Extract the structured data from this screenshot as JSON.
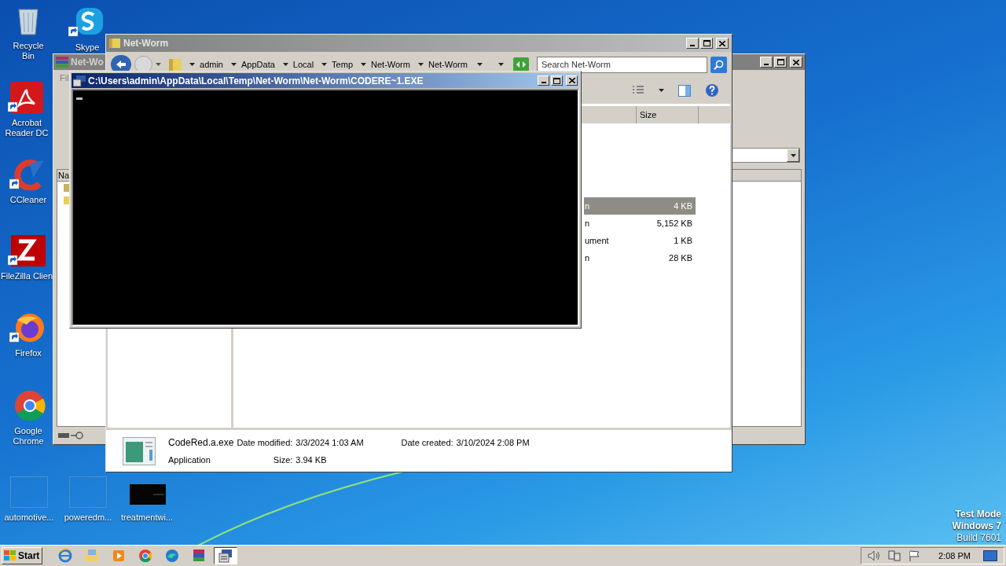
{
  "desktop_icons": [
    {
      "label": "Recycle Bin",
      "kind": "recycle"
    },
    {
      "label": "Skype",
      "kind": "skype"
    },
    {
      "label": "Acrobat Reader DC",
      "kind": "acrobat"
    },
    {
      "label": "CCleaner",
      "kind": "ccleaner"
    },
    {
      "label": "FileZilla Clien",
      "kind": "filezilla"
    },
    {
      "label": "Firefox",
      "kind": "firefox"
    },
    {
      "label": "Google Chrome",
      "kind": "chrome"
    },
    {
      "label": "automotive...",
      "kind": "blank"
    },
    {
      "label": "poweredm...",
      "kind": "blank"
    },
    {
      "label": "treatmentwi...",
      "kind": "dark"
    }
  ],
  "winrar_window": {
    "title": "Net-Wo",
    "menu": [
      "Fil"
    ],
    "list_header": "Na"
  },
  "explorer_window": {
    "title": "Net-Worm",
    "breadcrumb": [
      "admin",
      "AppData",
      "Local",
      "Temp",
      "Net-Worm",
      "Net-Worm"
    ],
    "search": {
      "placeholder": "Search Net-Worm"
    },
    "columns": [
      "Size"
    ],
    "rows": [
      {
        "type": "n",
        "size": "4 KB",
        "selected": true
      },
      {
        "type": "n",
        "size": "5,152 KB",
        "selected": false
      },
      {
        "type": "ument",
        "size": "1 KB",
        "selected": false
      },
      {
        "type": "n",
        "size": "28 KB",
        "selected": false
      }
    ],
    "details": {
      "name": "CodeRed.a.exe",
      "type": "Application",
      "modified_label": "Date modified:",
      "modified": "3/3/2024 1:03 AM",
      "created_label": "Date created:",
      "created": "3/10/2024 2:08 PM",
      "size_label": "Size:",
      "size": "3.94 KB"
    }
  },
  "console_window": {
    "title": "C:\\Users\\admin\\AppData\\Local\\Temp\\Net-Worm\\Net-Worm\\CODERE~1.EXE"
  },
  "os_notice": [
    "Test Mode",
    "Windows 7",
    "Build 7601"
  ],
  "taskbar": {
    "start": "Start",
    "buttons": [
      {
        "kind": "ie",
        "selected": false
      },
      {
        "kind": "explorer",
        "selected": false
      },
      {
        "kind": "media",
        "selected": false
      },
      {
        "kind": "chrome",
        "selected": false
      },
      {
        "kind": "edge",
        "selected": false
      },
      {
        "kind": "winrar",
        "selected": false
      },
      {
        "kind": "console",
        "selected": true
      }
    ],
    "clock": "2:08 PM"
  }
}
